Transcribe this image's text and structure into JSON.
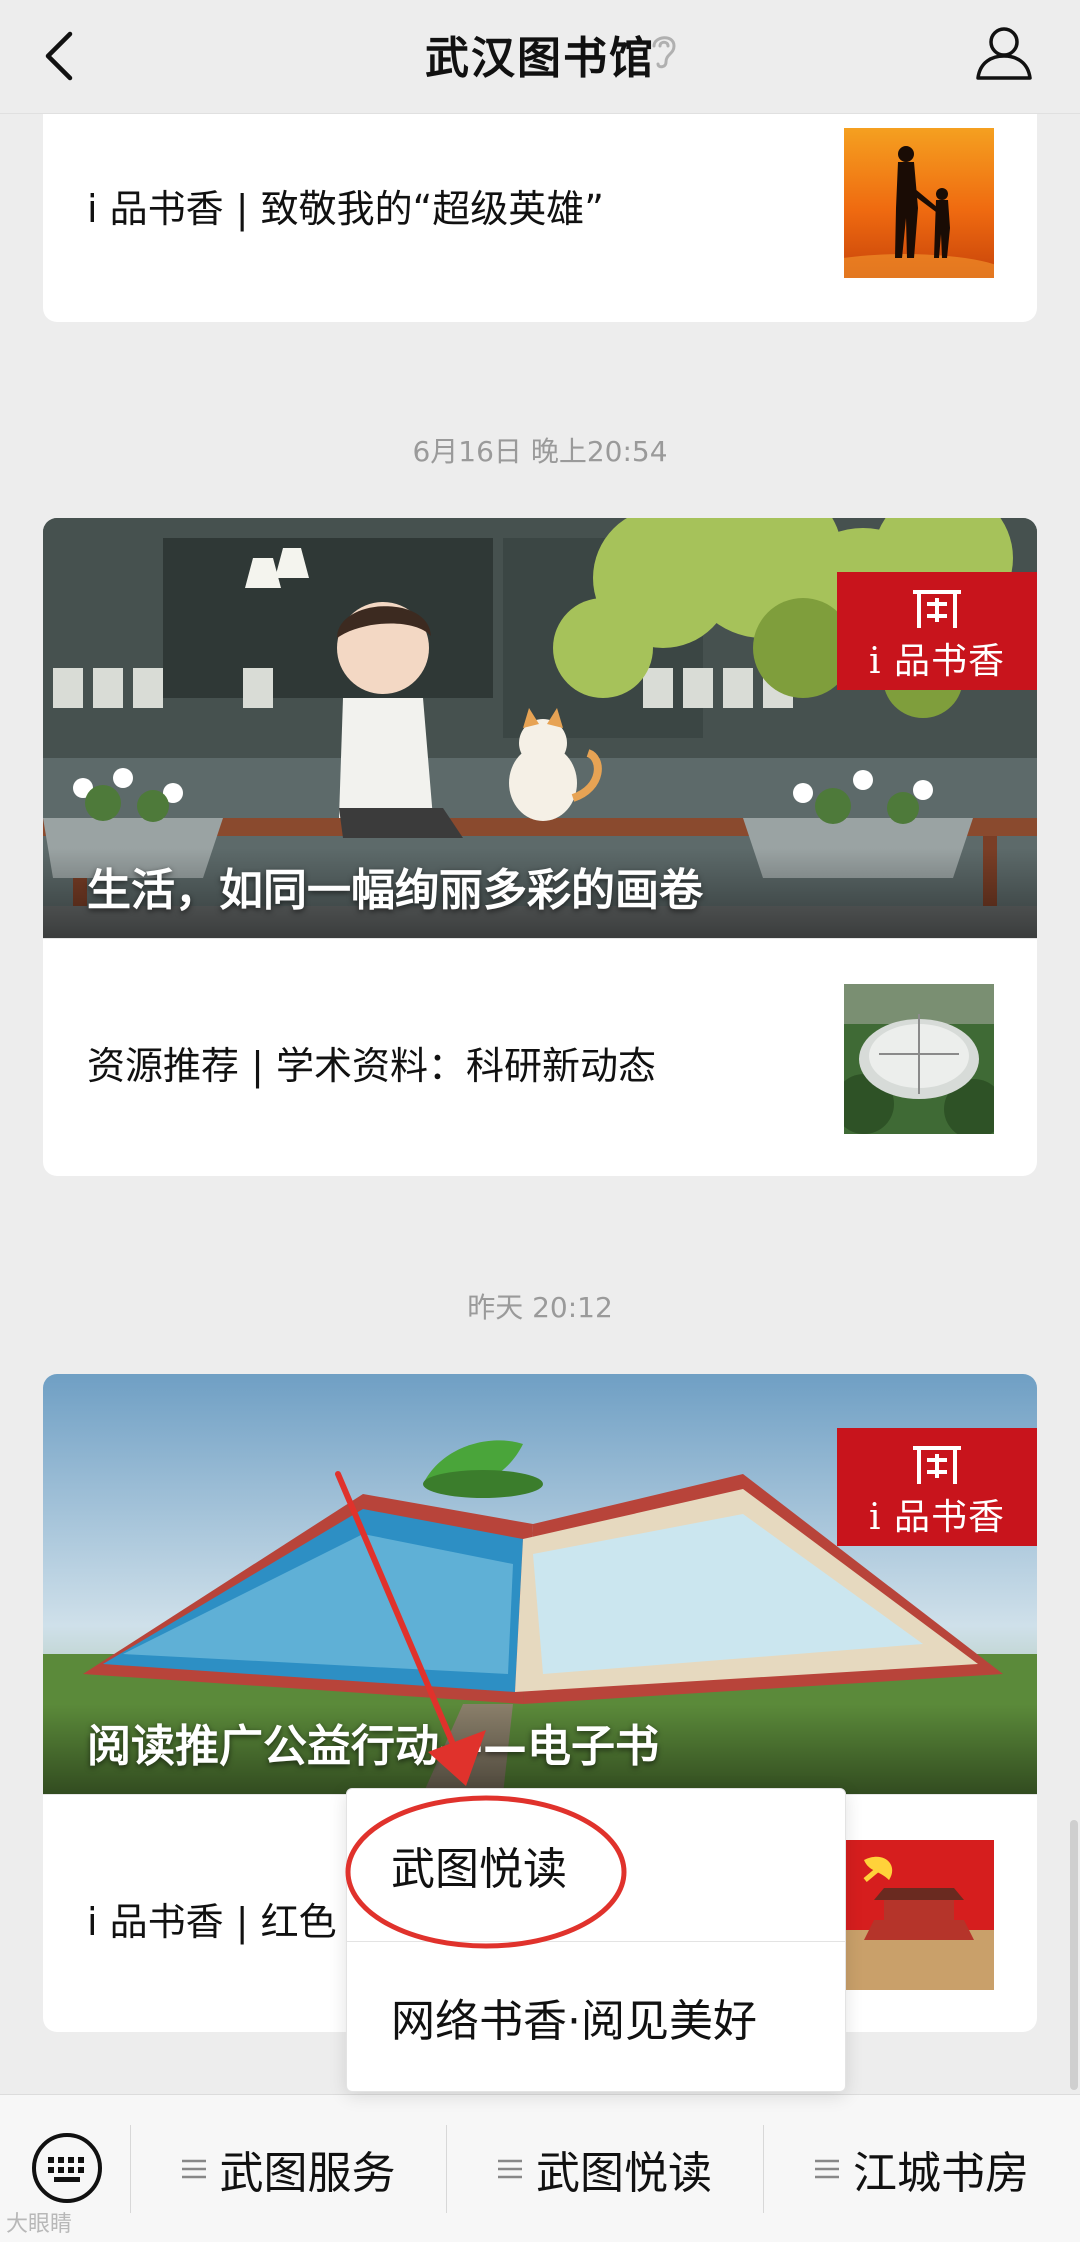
{
  "header": {
    "title": "武汉图书馆"
  },
  "feed": {
    "card1": {
      "text": "i 品书香 | 致敬我的“超级英雄”"
    },
    "timestamp1": "6月16日 晚上20:54",
    "card2": {
      "cover_title": "生活，如同一幅绚丽多彩的画卷",
      "badge": "i 品书香",
      "text": "资源推荐 | 学术资料：科研新动态"
    },
    "timestamp2": "昨天 20:12",
    "card3": {
      "cover_title": "阅读推广公益行动——电子书",
      "badge": "i 品书香",
      "text": "i 品书香 | 红色"
    }
  },
  "popup_menu": {
    "items": [
      "武图悦读",
      "网络书香·阅见美好"
    ]
  },
  "bottom_menu": {
    "items": [
      "武图服务",
      "武图悦读",
      "江城书房"
    ]
  },
  "watermark": "大眼睛",
  "colors": {
    "badge_red": "#c8141c",
    "annotation_red": "#e0322c",
    "background": "#ededed"
  },
  "icons": [
    "back-arrow-icon",
    "ear-icon",
    "user-icon",
    "keyboard-icon",
    "hamburger-icon"
  ]
}
